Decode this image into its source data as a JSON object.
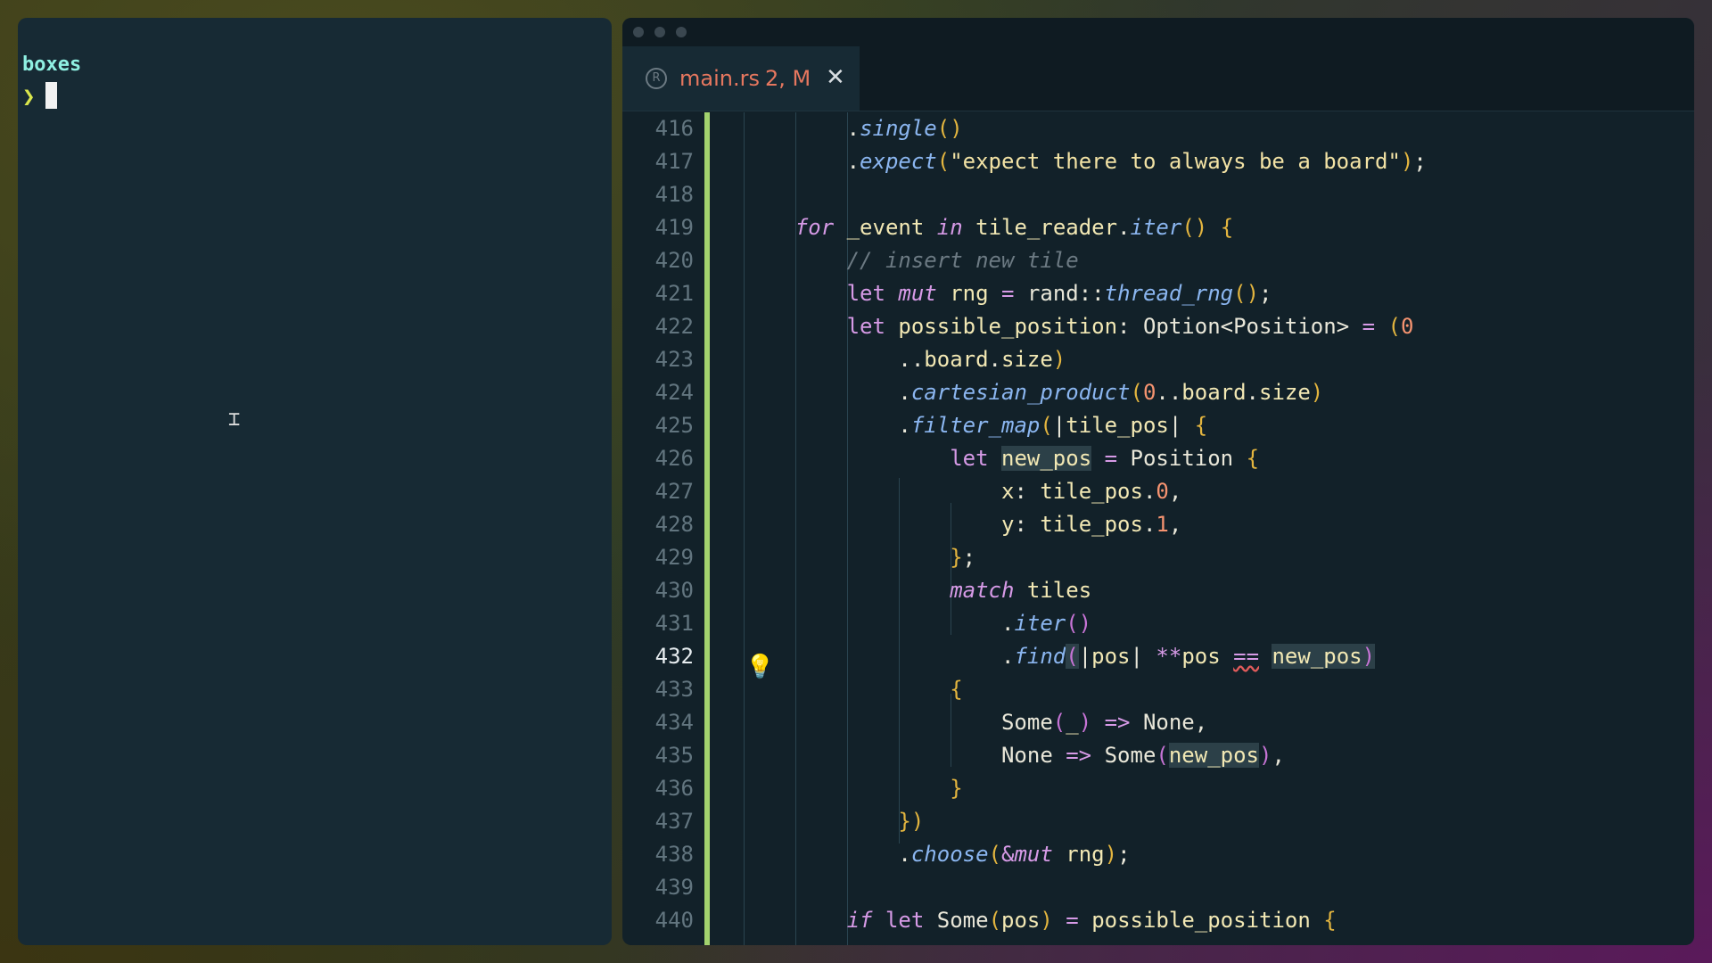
{
  "terminal": {
    "title": "boxes",
    "prompt": "❯"
  },
  "editor": {
    "tab": {
      "filename": "main.rs",
      "status": "2, M",
      "close_glyph": "✕"
    },
    "accent_color": "#a2d26d",
    "active_line": 432,
    "lines": [
      {
        "n": "416",
        "html": "        <span class=\"pun\">.</span><span class=\"fn\">single</span><span class=\"par\">()</span>"
      },
      {
        "n": "417",
        "html": "        <span class=\"pun\">.</span><span class=\"fn\">expect</span><span class=\"par\">(</span><span class=\"str\">\"expect there to always be a board\"</span><span class=\"par\">)</span><span class=\"pun\">;</span>"
      },
      {
        "n": "418",
        "html": ""
      },
      {
        "n": "419",
        "html": "    <span class=\"kw\">for</span> <span class=\"id\">_event</span> <span class=\"kw\">in</span> <span class=\"id\">tile_reader</span><span class=\"pun\">.</span><span class=\"fn\">iter</span><span class=\"par\">()</span> <span class=\"par\">{</span>"
      },
      {
        "n": "420",
        "html": "        <span class=\"cm\">// insert new tile</span>"
      },
      {
        "n": "421",
        "html": "        <span class=\"kw2\">let</span> <span class=\"kw\">mut</span> <span class=\"id\">rng</span> <span class=\"op\">=</span> <span class=\"ty\">rand</span><span class=\"pun\">::</span><span class=\"fn\">thread_rng</span><span class=\"par\">()</span><span class=\"pun\">;</span>"
      },
      {
        "n": "422",
        "html": "        <span class=\"kw2\">let</span> <span class=\"id\">possible_position</span><span class=\"pun\">:</span> <span class=\"ty\">Option</span><span class=\"pun\">&lt;</span><span class=\"ty\">Position</span><span class=\"pun\">&gt;</span> <span class=\"op\">=</span> <span class=\"par\">(</span><span class=\"num\">0</span>"
      },
      {
        "n": "423",
        "html": "            <span class=\"pun\">..</span><span class=\"id\">board</span><span class=\"pun\">.</span><span class=\"id\">size</span><span class=\"par\">)</span>"
      },
      {
        "n": "424",
        "html": "            <span class=\"pun\">.</span><span class=\"fn\">cartesian_product</span><span class=\"par\">(</span><span class=\"num\">0</span><span class=\"pun\">..</span><span class=\"id\">board</span><span class=\"pun\">.</span><span class=\"id\">size</span><span class=\"par\">)</span>"
      },
      {
        "n": "425",
        "html": "            <span class=\"pun\">.</span><span class=\"fn\">filter_map</span><span class=\"par\">(</span><span class=\"pun\">|</span><span class=\"id\">tile_pos</span><span class=\"pun\">|</span> <span class=\"par\">{</span>"
      },
      {
        "n": "426",
        "html": "                <span class=\"kw2\">let</span> <span class=\"id hl\">new_pos</span> <span class=\"op\">=</span> <span class=\"ty\">Position</span> <span class=\"par\">{</span>"
      },
      {
        "n": "427",
        "html": "                    <span class=\"id\">x</span><span class=\"pun\">:</span> <span class=\"id\">tile_pos</span><span class=\"pun\">.</span><span class=\"num\">0</span><span class=\"pun\">,</span>"
      },
      {
        "n": "428",
        "html": "                    <span class=\"id\">y</span><span class=\"pun\">:</span> <span class=\"id\">tile_pos</span><span class=\"pun\">.</span><span class=\"num\">1</span><span class=\"pun\">,</span>"
      },
      {
        "n": "429",
        "html": "                <span class=\"par\">}</span><span class=\"pun\">;</span>"
      },
      {
        "n": "430",
        "html": "                <span class=\"kw\">match</span> <span class=\"id\">tiles</span>"
      },
      {
        "n": "431",
        "html": "                    <span class=\"pun\">.</span><span class=\"fn\">iter</span><span class=\"par2\">()</span>"
      },
      {
        "n": "432",
        "html": "                    <span class=\"pun\">.</span><span class=\"fn\">find</span><span class=\"par2 hl\">(</span><span class=\"pun\">|</span><span class=\"id\">pos</span><span class=\"pun\">|</span> <span class=\"op\">**</span><span class=\"id\">pos</span> <span class=\"op sq\">==</span> <span class=\"id hl\">new_pos</span><span class=\"par2 hl\">)</span>"
      },
      {
        "n": "433",
        "html": "                <span class=\"par\">{</span>"
      },
      {
        "n": "434",
        "html": "                    <span class=\"ty\">Some</span><span class=\"par2\">(</span><span class=\"id\">_</span><span class=\"par2\">)</span> <span class=\"op\">=&gt;</span> <span class=\"ty\">None</span><span class=\"pun\">,</span>"
      },
      {
        "n": "435",
        "html": "                    <span class=\"ty\">None</span> <span class=\"op\">=&gt;</span> <span class=\"ty\">Some</span><span class=\"par2\">(</span><span class=\"id hl\">new_pos</span><span class=\"par2\">)</span><span class=\"pun\">,</span>"
      },
      {
        "n": "436",
        "html": "                <span class=\"par\">}</span>"
      },
      {
        "n": "437",
        "html": "            <span class=\"par\">})</span>"
      },
      {
        "n": "438",
        "html": "            <span class=\"pun\">.</span><span class=\"fn\">choose</span><span class=\"par\">(</span><span class=\"op\">&amp;</span><span class=\"kw\">mut</span> <span class=\"id\">rng</span><span class=\"par\">)</span><span class=\"pun\">;</span>"
      },
      {
        "n": "439",
        "html": ""
      },
      {
        "n": "440",
        "html": "        <span class=\"kw\">if</span> <span class=\"kw2\">let</span> <span class=\"ty\">Some</span><span class=\"par\">(</span><span class=\"id\">pos</span><span class=\"par\">)</span> <span class=\"op\">=</span> <span class=\"id\">possible_position</span> <span class=\"par\">{</span>"
      }
    ]
  }
}
